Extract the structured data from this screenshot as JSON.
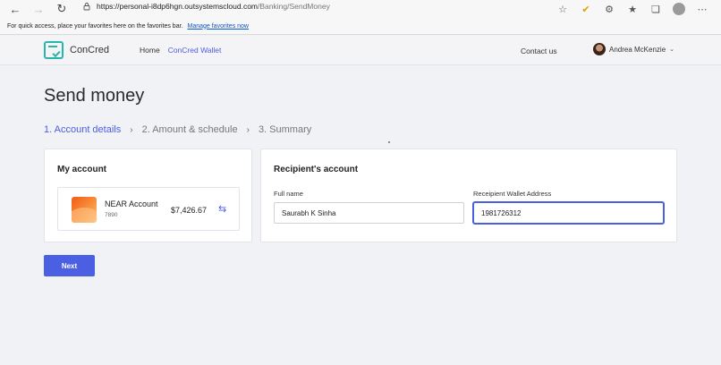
{
  "browser": {
    "url_host": "https://personal-i8dp6hgn.outsystemscloud.com",
    "url_path": "/Banking/SendMoney",
    "favorites_prompt": "For quick access, place your favorites here on the favorites bar.",
    "favorites_link": "Manage favorites now"
  },
  "header": {
    "brand": "ConCred",
    "nav": {
      "home": "Home",
      "wallet": "ConCred Wallet"
    },
    "contact": "Contact us",
    "user_name": "Andrea McKenzie"
  },
  "page": {
    "title": "Send money",
    "steps": [
      "1. Account details",
      "2. Amount & schedule",
      "3. Summary"
    ],
    "active_step": 0
  },
  "my_account": {
    "title": "My account",
    "account_name": "NEAR Account",
    "account_number": "7890",
    "balance": "$7,426.67"
  },
  "recipient": {
    "title": "Recipient's account",
    "full_name_label": "Full name",
    "full_name_value": "Saurabh K Sinha",
    "wallet_label": "Receipient Wallet Address",
    "wallet_value": "1981726312"
  },
  "actions": {
    "next": "Next"
  },
  "colors": {
    "accent": "#4b5fe3",
    "brand": "#27b7a8"
  }
}
